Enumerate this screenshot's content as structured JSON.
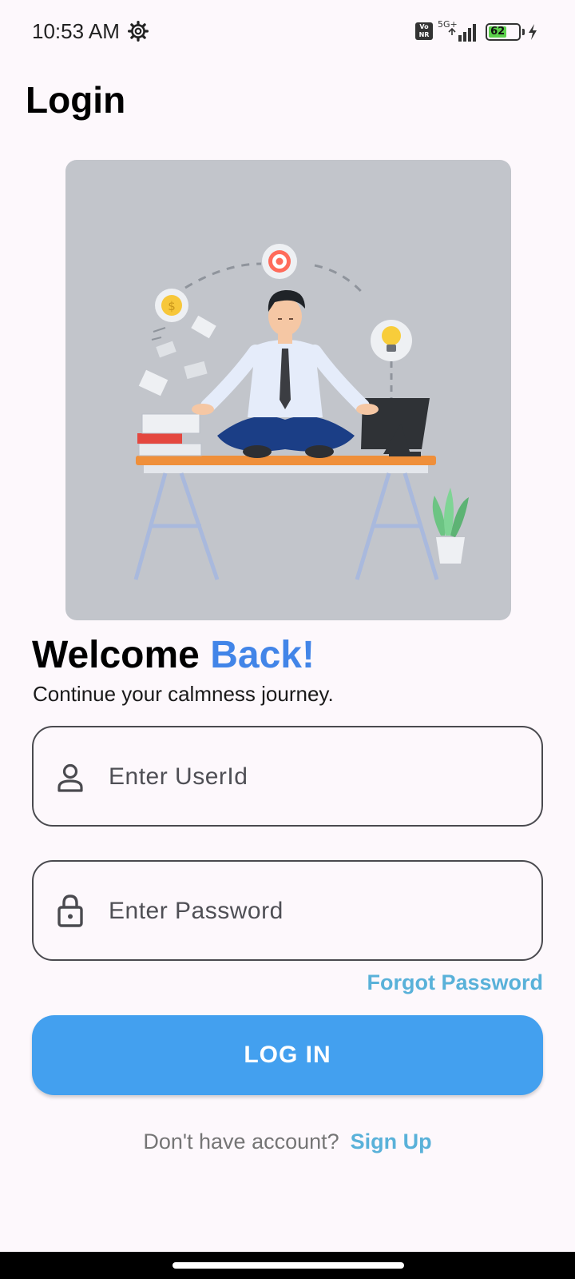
{
  "status_bar": {
    "time": "10:53 AM",
    "volte": "Vo\nNR",
    "network": "5G+",
    "battery_percent": "62",
    "battery_level": 0.62
  },
  "header": {
    "title": "Login"
  },
  "hero": {
    "illustration": "meditating-office-worker"
  },
  "welcome": {
    "heading_plain": "Welcome ",
    "heading_accent": "Back!",
    "accent_color": "#4285e8",
    "subtitle": "Continue your calmness journey."
  },
  "form": {
    "userid_placeholder": "Enter UserId",
    "userid_value": "",
    "password_placeholder": "Enter Password",
    "password_value": "",
    "forgot_label": "Forgot Password",
    "login_label": "LOG IN",
    "login_color": "#43a0ef"
  },
  "footer": {
    "prompt": "Don't have account?",
    "signup_label": "Sign Up"
  }
}
